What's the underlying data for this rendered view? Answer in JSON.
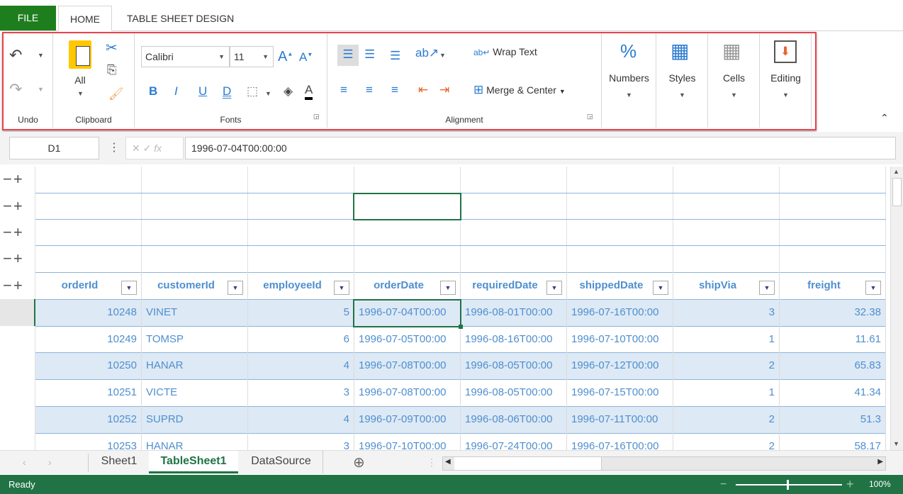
{
  "tabs": {
    "file": "FILE",
    "home": "HOME",
    "design": "TABLE SHEET DESIGN"
  },
  "ribbon": {
    "undo": {
      "label": "Undo"
    },
    "clipboard": {
      "label": "Clipboard",
      "paste": "All"
    },
    "fonts": {
      "label": "Fonts",
      "font": "Calibri",
      "size": "11",
      "bold": "B",
      "italic": "I",
      "underline": "U",
      "double_underline": "D",
      "font_color": "A"
    },
    "alignment": {
      "label": "Alignment",
      "wrap": "Wrap Text",
      "merge": "Merge & Center"
    },
    "numbers": "Numbers",
    "styles": "Styles",
    "cells": "Cells",
    "editing": "Editing"
  },
  "formula_bar": {
    "name_box": "D1",
    "fx": "fx",
    "value": "1996-07-04T00:00:00"
  },
  "table": {
    "columns": [
      "orderId",
      "customerId",
      "employeeId",
      "orderDate",
      "requiredDate",
      "shippedDate",
      "shipVia",
      "freight"
    ],
    "rows": [
      [
        "10248",
        "VINET",
        "5",
        "1996-07-04T00:00",
        "1996-08-01T00:00",
        "1996-07-16T00:00",
        "3",
        "32.38"
      ],
      [
        "10249",
        "TOMSP",
        "6",
        "1996-07-05T00:00",
        "1996-08-16T00:00",
        "1996-07-10T00:00",
        "1",
        "11.61"
      ],
      [
        "10250",
        "HANAR",
        "4",
        "1996-07-08T00:00",
        "1996-08-05T00:00",
        "1996-07-12T00:00",
        "2",
        "65.83"
      ],
      [
        "10251",
        "VICTE",
        "3",
        "1996-07-08T00:00",
        "1996-08-05T00:00",
        "1996-07-15T00:00",
        "1",
        "41.34"
      ],
      [
        "10252",
        "SUPRD",
        "4",
        "1996-07-09T00:00",
        "1996-08-06T00:00",
        "1996-07-11T00:00",
        "2",
        "51.3"
      ],
      [
        "10253",
        "HANAR",
        "3",
        "1996-07-10T00:00",
        "1996-07-24T00:00",
        "1996-07-16T00:00",
        "2",
        "58.17"
      ]
    ]
  },
  "sheets": [
    "Sheet1",
    "TableSheet1",
    "DataSource"
  ],
  "active_sheet": "TableSheet1",
  "status": {
    "text": "Ready",
    "zoom": "100%",
    "zoom_level": 100
  },
  "colors": {
    "file": "#1e7e1e",
    "status": "#217346",
    "accent": "#4f8fcf",
    "band": "#dde9f5",
    "highlight": "#e9434a"
  }
}
